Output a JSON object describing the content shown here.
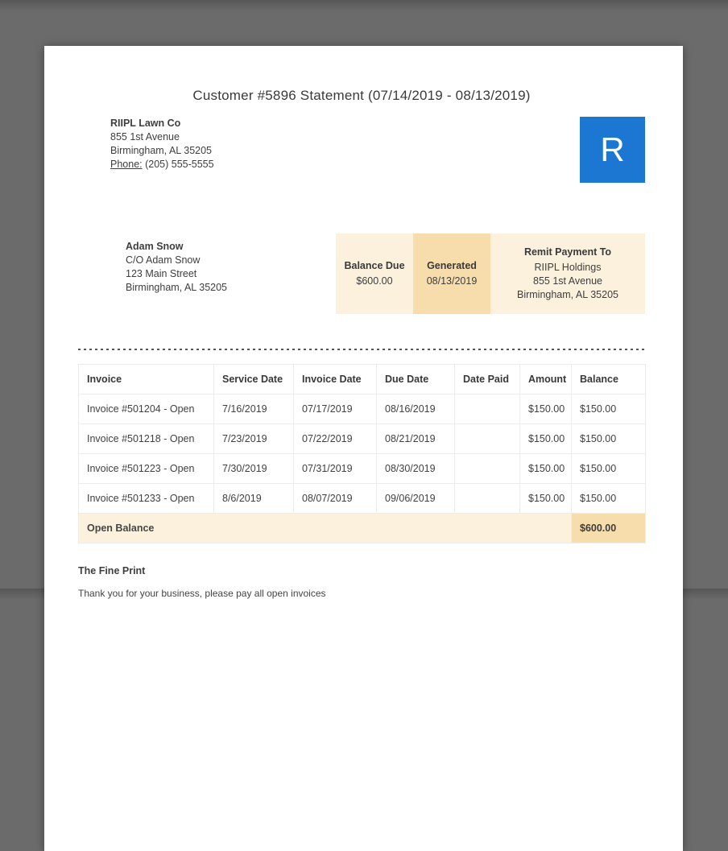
{
  "page": {
    "title": "Customer #5896 Statement (07/14/2019 - 08/13/2019)"
  },
  "company": {
    "name": "RIIPL Lawn Co",
    "address_line1": "855 1st Avenue",
    "address_line2": "Birmingham, AL 35205",
    "phone_label": "Phone:",
    "phone_value": "(205) 555-5555"
  },
  "logo": {
    "letter": "R"
  },
  "customer": {
    "name": "Adam Snow",
    "line1": "C/O Adam Snow",
    "line2": "123 Main Street",
    "line3": "Birmingham, AL 35205"
  },
  "summary": {
    "balance_due_label": "Balance Due",
    "balance_due_value": "$600.00",
    "generated_label": "Generated",
    "generated_value": "08/13/2019",
    "remit_label": "Remit Payment To",
    "remit_line1": "RIIPL Holdings",
    "remit_line2": "855 1st Avenue",
    "remit_line3": "Birmingham, AL 35205"
  },
  "table": {
    "headers": [
      "Invoice",
      "Service Date",
      "Invoice Date",
      "Due Date",
      "Date Paid",
      "Amount",
      "Balance"
    ],
    "rows": [
      [
        "Invoice #501204 - Open",
        "7/16/2019",
        "07/17/2019",
        "08/16/2019",
        "",
        "$150.00",
        "$150.00"
      ],
      [
        "Invoice #501218 - Open",
        "7/23/2019",
        "07/22/2019",
        "08/21/2019",
        "",
        "$150.00",
        "$150.00"
      ],
      [
        "Invoice #501223 - Open",
        "7/30/2019",
        "07/31/2019",
        "08/30/2019",
        "",
        "$150.00",
        "$150.00"
      ],
      [
        "Invoice #501233 - Open",
        "8/6/2019",
        "08/07/2019",
        "09/06/2019",
        "",
        "$150.00",
        "$150.00"
      ]
    ],
    "footer_label": "Open Balance",
    "footer_balance": "$600.00"
  },
  "fine_print": {
    "heading": "The Fine Print",
    "body": "Thank you for your business, please pay all open invoices"
  },
  "colors": {
    "brand_blue": "#1b77d2",
    "highlight_light": "#fcf1dd",
    "highlight_dark": "#f7ddab",
    "canvas": "#6b6b6b"
  }
}
